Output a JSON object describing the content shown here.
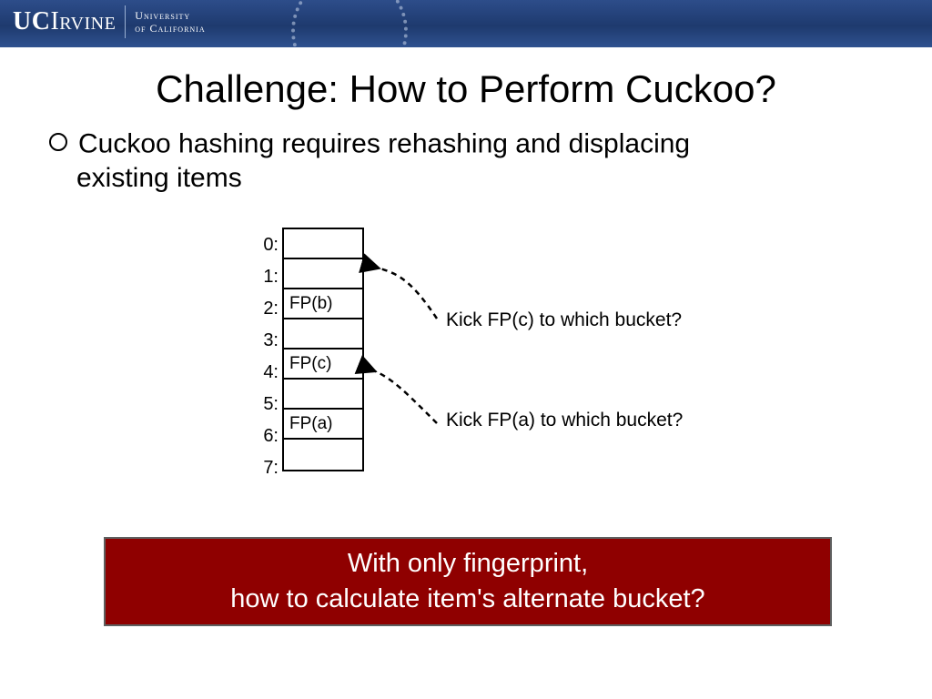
{
  "header": {
    "logo_primary": "UCIrvine",
    "logo_sub1": "University",
    "logo_sub2": "of California"
  },
  "title": "Challenge: How to Perform Cuckoo?",
  "bullet": {
    "line1": "Cuckoo hashing requires rehashing and displacing",
    "line2": "existing items"
  },
  "buckets": {
    "labels": [
      "0:",
      "1:",
      "2:",
      "3:",
      "4:",
      "5:",
      "6:",
      "7:"
    ],
    "contents": [
      "",
      "",
      "FP(b)",
      "",
      "FP(c)",
      "",
      "FP(a)",
      ""
    ]
  },
  "annotations": {
    "a1": "Kick FP(c) to which bucket?",
    "a2": "Kick FP(a) to which bucket?"
  },
  "callout": {
    "line1": "With only fingerprint,",
    "line2": "how to calculate item's alternate bucket?"
  }
}
